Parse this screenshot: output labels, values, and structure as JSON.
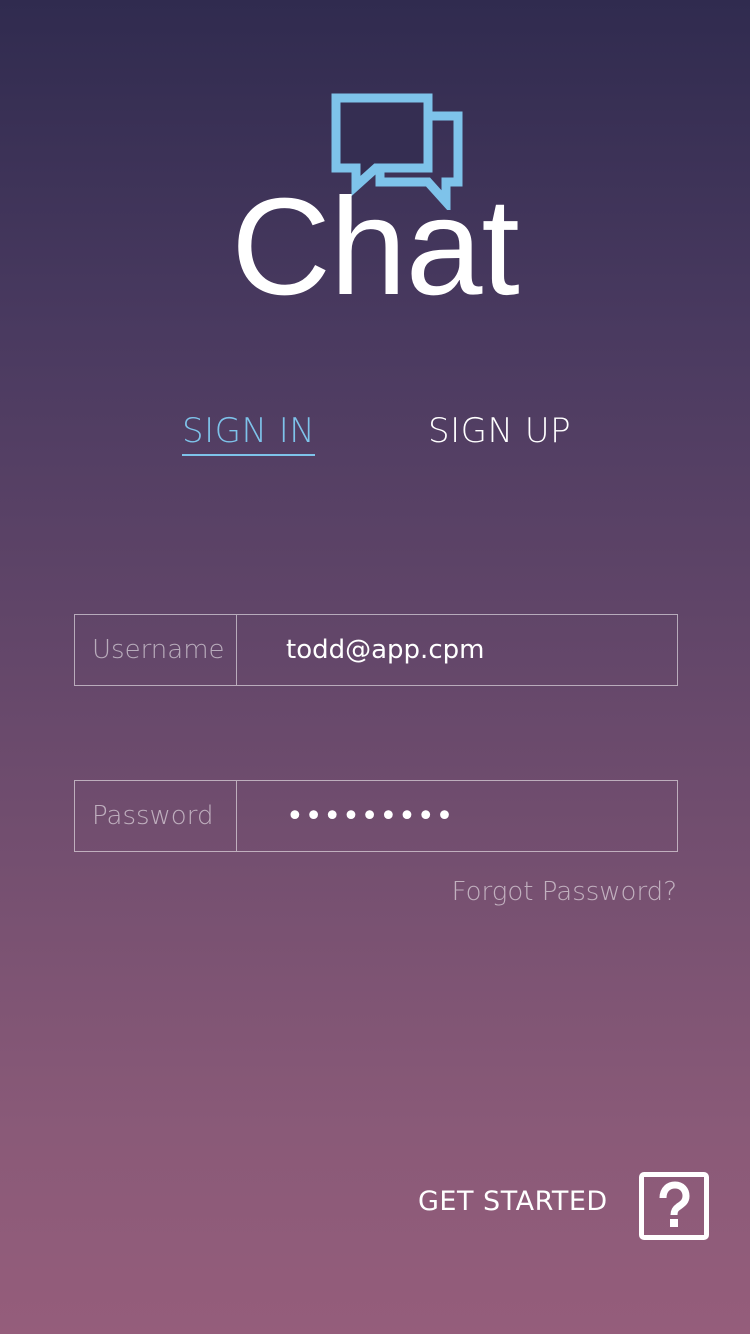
{
  "app": {
    "title": "Chat",
    "accent_color": "#7ec3ea",
    "logo_icon": "chat-bubbles-icon"
  },
  "tabs": [
    {
      "label": "SIGN IN",
      "active": true
    },
    {
      "label": "SIGN UP",
      "active": false
    }
  ],
  "form": {
    "username": {
      "label": "Username",
      "value": "todd@app.cpm"
    },
    "password": {
      "label": "Password",
      "value": "•••••••••"
    },
    "forgot_password": "Forgot Password?"
  },
  "footer": {
    "get_started": "GET STARTED",
    "help_icon": "question-mark-icon"
  }
}
